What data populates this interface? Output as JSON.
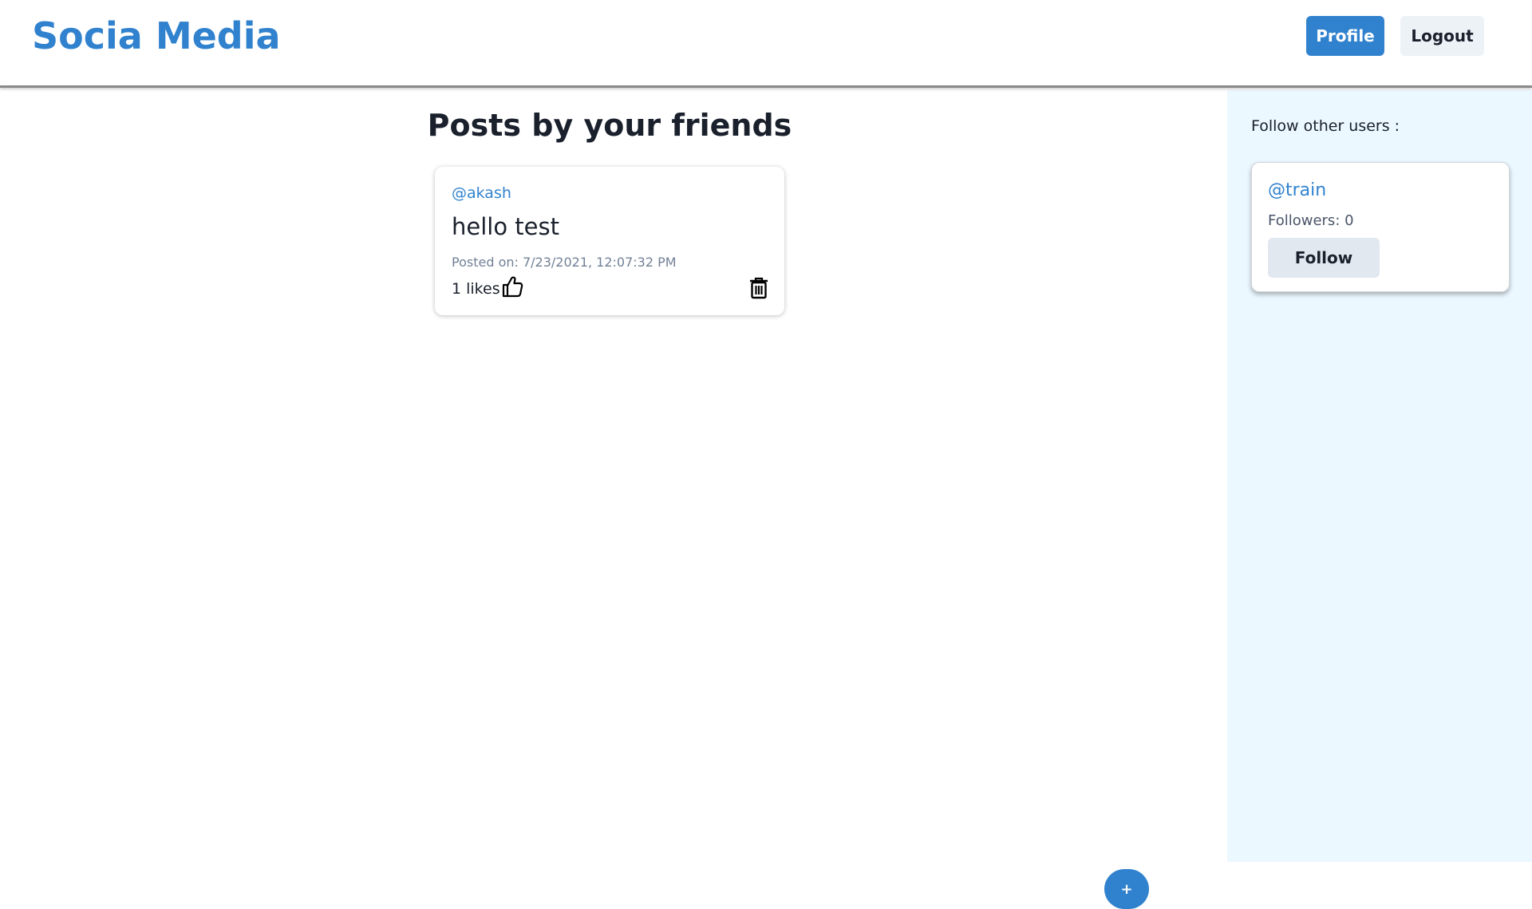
{
  "header": {
    "brand": "Socia Media",
    "profile_label": "Profile",
    "logout_label": "Logout"
  },
  "feed": {
    "title": "Posts by your friends",
    "posts": [
      {
        "author": "@akash",
        "content": "hello test",
        "date": "Posted on: 7/23/2021, 12:07:32 PM",
        "likes": "1 likes",
        "like_icon": "thumbs-up-icon",
        "delete_icon": "trash-icon"
      }
    ]
  },
  "fab": {
    "label": "+"
  },
  "sidebar": {
    "heading": "Follow other users :",
    "users": [
      {
        "handle": "@train",
        "followers": "Followers: 0",
        "follow_label": "Follow"
      }
    ]
  },
  "colors": {
    "accent": "#3182ce",
    "sidebar_bg": "#ebf8ff",
    "secondary_button_bg": "#edf2f7"
  }
}
